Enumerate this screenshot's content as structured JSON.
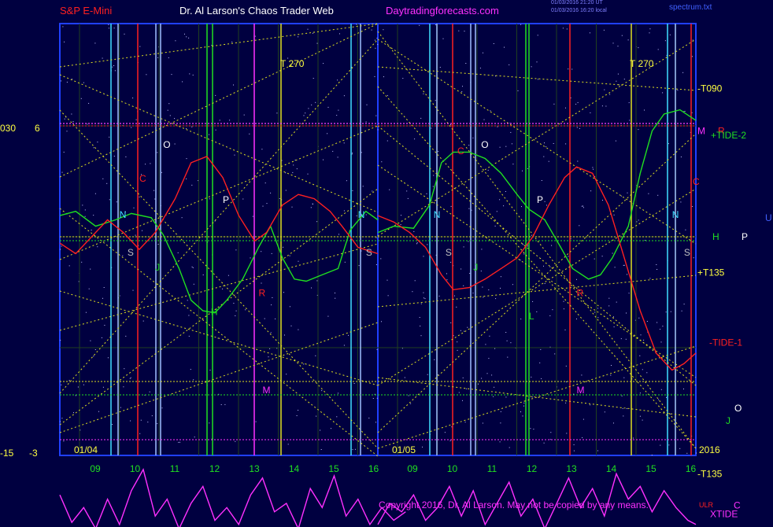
{
  "header": {
    "instrument": "S&P E-Mini",
    "site_title": "Dr. Al Larson's Chaos Trader Web",
    "site_url": "Daytradingforecasts.com",
    "stamp_1": "01/03/2016 21:20 UT",
    "stamp_2": "01/03/2016 16:20 local",
    "file_label": "spectrum.txt"
  },
  "footer": {
    "copyright": "Copyright 2016, Dr. Al Larson. May not be copied by any means.",
    "mark": "ULR"
  },
  "colors": {
    "background": "#000040",
    "frame": "#2040ff",
    "red_line": "#ff2020",
    "green_line": "#20e020",
    "magenta_line": "#ff30ff",
    "yellow_dotted": "#e0e020",
    "cyan_line": "#40e0ff",
    "light_blue_line": "#a0c0ff"
  },
  "chart_data": {
    "type": "line",
    "panels": [
      "01/04",
      "01/05"
    ],
    "x_tick_labels": [
      "09",
      "10",
      "11",
      "12",
      "13",
      "14",
      "15",
      "16",
      "09",
      "10",
      "11",
      "12",
      "13",
      "14",
      "15",
      "16"
    ],
    "left_axis_labels": {
      "upper": [
        "030",
        "6"
      ],
      "lower": [
        "-15",
        "-3"
      ]
    },
    "year_label": "2016",
    "series": [
      {
        "name": "+TIDE-2",
        "color": "#20e020",
        "x": [
          8.0,
          8.4,
          8.9,
          9.4,
          9.8,
          10.3,
          10.6,
          11.0,
          11.3,
          11.6,
          11.9,
          12.2,
          12.6,
          13.0,
          13.3,
          13.6,
          13.9,
          14.2,
          14.6,
          15.0,
          15.3,
          15.7,
          16.0,
          24.0,
          24.4,
          24.9,
          25.3,
          25.6,
          25.9,
          26.3,
          26.7,
          27.1,
          27.5,
          27.8,
          28.2,
          28.6,
          28.9,
          29.3,
          29.6,
          29.9,
          30.3,
          30.6,
          30.9,
          31.2,
          31.6,
          32.0
        ],
        "y": [
          1.0,
          1.2,
          0.5,
          0.8,
          1.1,
          0.9,
          0.1,
          -1.5,
          -3.0,
          -3.5,
          -3.6,
          -3.0,
          -2.0,
          -0.5,
          0.5,
          -1.0,
          -2.0,
          -2.1,
          -1.8,
          -1.5,
          0.3,
          1.2,
          0.8,
          0.2,
          0.5,
          0.4,
          1.5,
          3.5,
          4.0,
          4.0,
          3.7,
          3.0,
          2.0,
          1.3,
          0.8,
          -0.5,
          -1.5,
          -2.0,
          -1.8,
          -1.0,
          0.5,
          3.0,
          5.0,
          5.8,
          6.0,
          5.5
        ]
      },
      {
        "name": "-TIDE-1",
        "color": "#ff2020",
        "x": [
          8.0,
          8.4,
          8.8,
          9.2,
          9.6,
          10.0,
          10.4,
          10.9,
          11.3,
          11.7,
          12.1,
          12.5,
          12.9,
          13.2,
          13.6,
          14.0,
          14.4,
          14.8,
          15.1,
          15.5,
          16.0,
          24.0,
          24.4,
          24.8,
          25.2,
          25.6,
          25.9,
          26.3,
          26.7,
          27.1,
          27.5,
          27.9,
          28.3,
          28.7,
          29.0,
          29.4,
          29.8,
          30.2,
          30.6,
          31.0,
          31.4,
          31.7,
          32.0
        ],
        "y": [
          -0.3,
          -0.8,
          0.0,
          0.8,
          0.2,
          -0.6,
          0.2,
          1.8,
          3.5,
          3.8,
          2.8,
          1.0,
          -0.2,
          0.2,
          1.5,
          2.0,
          1.8,
          1.2,
          0.5,
          -0.5,
          -0.8,
          1.0,
          0.7,
          0.2,
          -0.5,
          -1.8,
          -2.5,
          -2.4,
          -2.0,
          -1.5,
          -1.0,
          0.0,
          1.5,
          2.8,
          3.3,
          3.0,
          1.5,
          -1.0,
          -3.5,
          -5.5,
          -6.3,
          -6.0,
          -5.5
        ]
      },
      {
        "name": "XTIDE",
        "color": "#ff30ff",
        "x": [
          8.0,
          8.3,
          8.6,
          8.9,
          9.2,
          9.5,
          9.8,
          10.1,
          10.4,
          10.7,
          11.0,
          11.3,
          11.6,
          11.9,
          12.2,
          12.5,
          12.8,
          13.1,
          13.4,
          13.7,
          14.0,
          14.3,
          14.6,
          14.9,
          15.2,
          15.5,
          15.8,
          16.1,
          16.4,
          16.7,
          24.0,
          24.3,
          24.6,
          24.9,
          25.2,
          25.5,
          25.8,
          26.1,
          26.4,
          26.7,
          27.0,
          27.3,
          27.6,
          27.9,
          28.2,
          28.5,
          28.8,
          29.1,
          29.4,
          29.7,
          30.0,
          30.3,
          30.6,
          30.9,
          31.2,
          31.5,
          31.8,
          32.0
        ],
        "y": [
          -12.2,
          -13.5,
          -12.8,
          -13.8,
          -12.4,
          -13.6,
          -12.0,
          -11.0,
          -13.2,
          -12.4,
          -13.8,
          -12.6,
          -11.8,
          -13.4,
          -12.8,
          -13.6,
          -12.2,
          -11.4,
          -13.0,
          -12.6,
          -13.8,
          -11.9,
          -12.8,
          -11.3,
          -13.2,
          -12.4,
          -13.6,
          -12.8,
          -13.4,
          -13.0,
          -13.6,
          -12.6,
          -13.0,
          -12.2,
          -13.4,
          -12.8,
          -11.8,
          -13.2,
          -12.0,
          -13.6,
          -12.6,
          -11.6,
          -13.2,
          -12.4,
          -13.8,
          -12.6,
          -11.4,
          -12.8,
          -11.9,
          -13.2,
          -11.2,
          -12.4,
          -11.8,
          -13.0,
          -12.0,
          -12.8,
          -13.4,
          -13.6
        ]
      }
    ],
    "panel_left": {
      "date": "01/04",
      "cycle_label": "T 270",
      "markers": [
        {
          "text": "O",
          "color": "#ffffff",
          "x": 10.6,
          "y": 4.2
        },
        {
          "text": "C",
          "color": "#ff2020",
          "x": 10.0,
          "y": 2.6
        },
        {
          "text": "P",
          "color": "#ffffff",
          "x": 12.1,
          "y": 1.6
        },
        {
          "text": "N",
          "color": "#40e0ff",
          "x": 9.5,
          "y": 0.9
        },
        {
          "text": "N",
          "color": "#40e0ff",
          "x": 15.5,
          "y": 0.9
        },
        {
          "text": "S",
          "color": "#c0c0c0",
          "x": 9.7,
          "y": -0.9
        },
        {
          "text": "S",
          "color": "#c0c0c0",
          "x": 15.7,
          "y": -0.9
        },
        {
          "text": "J",
          "color": "#20e020",
          "x": 10.4,
          "y": -1.6
        },
        {
          "text": "H",
          "color": "#20e020",
          "x": 11.8,
          "y": -3.7
        },
        {
          "text": "R",
          "color": "#ff2020",
          "x": 13.0,
          "y": -2.8
        },
        {
          "text": "M",
          "color": "#ff30ff",
          "x": 13.1,
          "y": -7.4
        }
      ]
    },
    "panel_right": {
      "date": "01/05",
      "cycle_label": "T 270",
      "markers": [
        {
          "text": "O",
          "color": "#ffffff",
          "x": 26.6,
          "y": 4.2
        },
        {
          "text": "C",
          "color": "#ff2020",
          "x": 26.0,
          "y": 3.9
        },
        {
          "text": "P",
          "color": "#ffffff",
          "x": 28.0,
          "y": 1.6
        },
        {
          "text": "N",
          "color": "#40e0ff",
          "x": 25.4,
          "y": 0.9
        },
        {
          "text": "N",
          "color": "#40e0ff",
          "x": 31.4,
          "y": 0.9
        },
        {
          "text": "S",
          "color": "#c0c0c0",
          "x": 25.7,
          "y": -0.9
        },
        {
          "text": "S",
          "color": "#c0c0c0",
          "x": 31.7,
          "y": -0.9
        },
        {
          "text": "J",
          "color": "#20e020",
          "x": 26.4,
          "y": -1.6
        },
        {
          "text": "L",
          "color": "#20e020",
          "x": 27.8,
          "y": -3.9
        },
        {
          "text": "R",
          "color": "#ff2020",
          "x": 29.0,
          "y": -2.8
        },
        {
          "text": "M",
          "color": "#ff30ff",
          "x": 29.0,
          "y": -7.4
        }
      ]
    },
    "right_labels": [
      {
        "text": "-T090",
        "color": "#ffff40",
        "y": 7.0
      },
      {
        "text": "M",
        "color": "#ff30ff",
        "y": 5.0
      },
      {
        "text": "R",
        "color": "#ff2020",
        "y": 5.0
      },
      {
        "text": "+TIDE-2",
        "color": "#20e020",
        "y": 4.8
      },
      {
        "text": "C",
        "color": "#ff2020",
        "y": 2.6
      },
      {
        "text": "U",
        "color": "#4060ff",
        "y": 0.9
      },
      {
        "text": "H",
        "color": "#20e020",
        "y": 0.0
      },
      {
        "text": "P",
        "color": "#ffffff",
        "y": 0.0
      },
      {
        "text": "+T135",
        "color": "#ffff40",
        "y": -1.7
      },
      {
        "text": "-TIDE-1",
        "color": "#ff2020",
        "y": -5.0
      },
      {
        "text": "O",
        "color": "#ffffff",
        "y": -8.1
      },
      {
        "text": "J",
        "color": "#20e020",
        "y": -8.7
      },
      {
        "text": "-T135",
        "color": "#ffff40",
        "y": -11.2
      },
      {
        "text": "C",
        "color": "#ff30ff",
        "y": -12.7
      },
      {
        "text": "XTIDE",
        "color": "#ff30ff",
        "y": -13.1
      }
    ],
    "grid": true,
    "legend": "right-margin labels"
  }
}
